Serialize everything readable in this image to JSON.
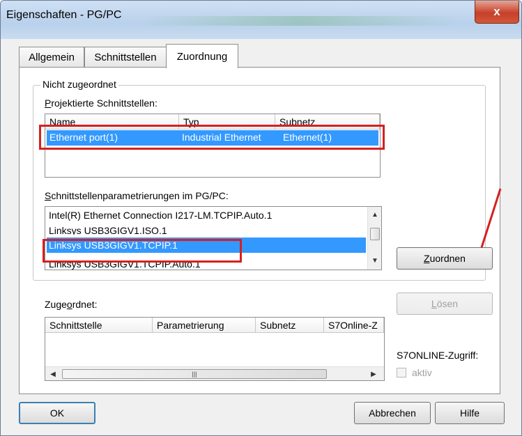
{
  "window": {
    "title": "Eigenschaften - PG/PC",
    "close_glyph": "x"
  },
  "tabs": [
    {
      "label": "Allgemein",
      "active": false
    },
    {
      "label": "Schnittstellen",
      "active": false
    },
    {
      "label": "Zuordnung",
      "active": true
    }
  ],
  "nicht_zugeordnet": {
    "legend": "Nicht zugeordnet",
    "projektierte_label": "Projektierte Schnittstellen:",
    "columns": [
      "Name",
      "Typ",
      "Subnetz"
    ],
    "rows": [
      {
        "name": "Ethernet port(1)",
        "typ": "Industrial Ethernet",
        "subnetz": "Ethernet(1)",
        "selected": true
      }
    ],
    "param_label": "Schnittstellenparametrierungen im PG/PC:",
    "param_items": [
      "Intel(R) Ethernet Connection I217-LM.TCPIP.Auto.1",
      "Linksys USB3GIGV1.ISO.1",
      "Linksys USB3GIGV1.TCPIP.1",
      "Linksys USB3GIGV1.TCPIP.Auto.1"
    ],
    "param_selected_index": 2,
    "zuordnen_button": "Zuordnen"
  },
  "zugeordnet": {
    "label": "Zugeordnet:",
    "columns": [
      "Schnittstelle",
      "Parametrierung",
      "Subnetz",
      "S7Online-Z"
    ],
    "loesen_button": "Lösen",
    "s7online_label": "S7ONLINE-Zugriff:",
    "aktiv_label": "aktiv",
    "aktiv_checked": false
  },
  "footer": {
    "ok": "OK",
    "abbrechen": "Abbrechen",
    "hilfe": "Hilfe"
  },
  "colors": {
    "selection": "#3399ff",
    "annotation": "#d62020"
  }
}
